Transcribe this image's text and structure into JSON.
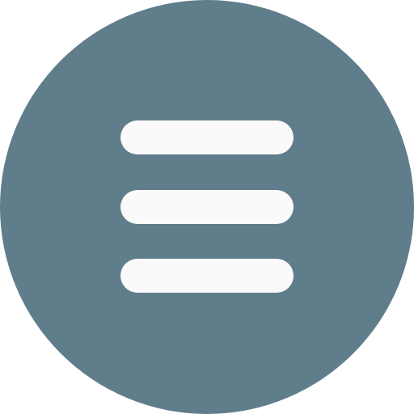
{
  "menu_button": {
    "icon": "hamburger-menu-icon",
    "background_color": "#607D8B",
    "bar_color": "#FAFAFA",
    "bar_count": 3
  }
}
